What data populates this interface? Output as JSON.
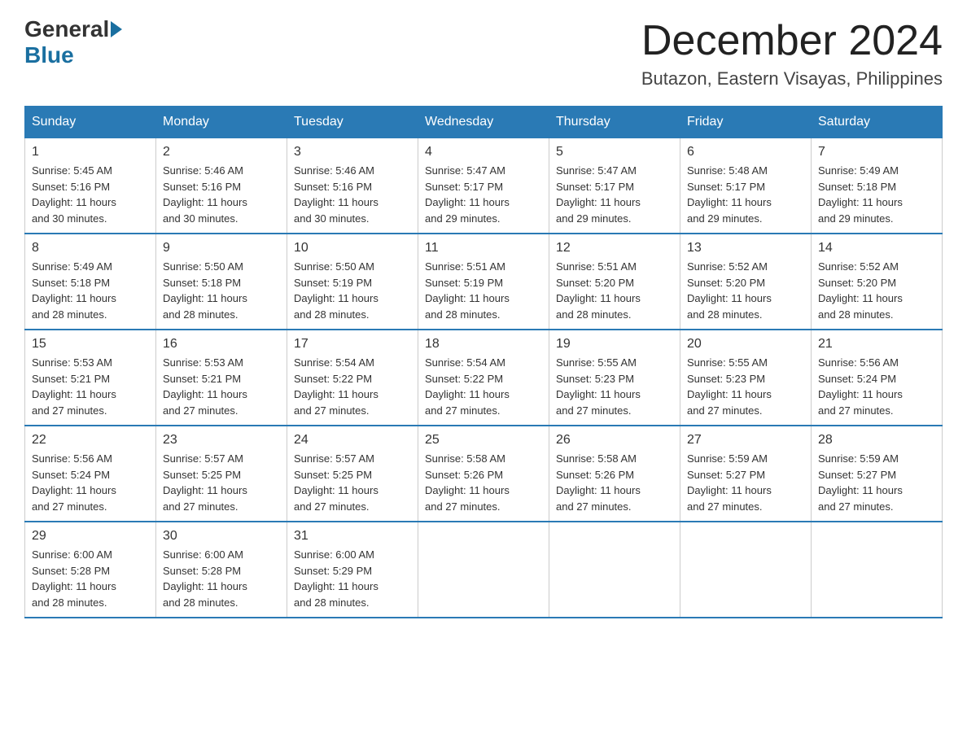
{
  "header": {
    "logo_general": "General",
    "logo_blue": "Blue",
    "month_title": "December 2024",
    "location": "Butazon, Eastern Visayas, Philippines"
  },
  "weekdays": [
    "Sunday",
    "Monday",
    "Tuesday",
    "Wednesday",
    "Thursday",
    "Friday",
    "Saturday"
  ],
  "weeks": [
    [
      {
        "day": "1",
        "sunrise": "5:45 AM",
        "sunset": "5:16 PM",
        "daylight": "11 hours and 30 minutes."
      },
      {
        "day": "2",
        "sunrise": "5:46 AM",
        "sunset": "5:16 PM",
        "daylight": "11 hours and 30 minutes."
      },
      {
        "day": "3",
        "sunrise": "5:46 AM",
        "sunset": "5:16 PM",
        "daylight": "11 hours and 30 minutes."
      },
      {
        "day": "4",
        "sunrise": "5:47 AM",
        "sunset": "5:17 PM",
        "daylight": "11 hours and 29 minutes."
      },
      {
        "day": "5",
        "sunrise": "5:47 AM",
        "sunset": "5:17 PM",
        "daylight": "11 hours and 29 minutes."
      },
      {
        "day": "6",
        "sunrise": "5:48 AM",
        "sunset": "5:17 PM",
        "daylight": "11 hours and 29 minutes."
      },
      {
        "day": "7",
        "sunrise": "5:49 AM",
        "sunset": "5:18 PM",
        "daylight": "11 hours and 29 minutes."
      }
    ],
    [
      {
        "day": "8",
        "sunrise": "5:49 AM",
        "sunset": "5:18 PM",
        "daylight": "11 hours and 28 minutes."
      },
      {
        "day": "9",
        "sunrise": "5:50 AM",
        "sunset": "5:18 PM",
        "daylight": "11 hours and 28 minutes."
      },
      {
        "day": "10",
        "sunrise": "5:50 AM",
        "sunset": "5:19 PM",
        "daylight": "11 hours and 28 minutes."
      },
      {
        "day": "11",
        "sunrise": "5:51 AM",
        "sunset": "5:19 PM",
        "daylight": "11 hours and 28 minutes."
      },
      {
        "day": "12",
        "sunrise": "5:51 AM",
        "sunset": "5:20 PM",
        "daylight": "11 hours and 28 minutes."
      },
      {
        "day": "13",
        "sunrise": "5:52 AM",
        "sunset": "5:20 PM",
        "daylight": "11 hours and 28 minutes."
      },
      {
        "day": "14",
        "sunrise": "5:52 AM",
        "sunset": "5:20 PM",
        "daylight": "11 hours and 28 minutes."
      }
    ],
    [
      {
        "day": "15",
        "sunrise": "5:53 AM",
        "sunset": "5:21 PM",
        "daylight": "11 hours and 27 minutes."
      },
      {
        "day": "16",
        "sunrise": "5:53 AM",
        "sunset": "5:21 PM",
        "daylight": "11 hours and 27 minutes."
      },
      {
        "day": "17",
        "sunrise": "5:54 AM",
        "sunset": "5:22 PM",
        "daylight": "11 hours and 27 minutes."
      },
      {
        "day": "18",
        "sunrise": "5:54 AM",
        "sunset": "5:22 PM",
        "daylight": "11 hours and 27 minutes."
      },
      {
        "day": "19",
        "sunrise": "5:55 AM",
        "sunset": "5:23 PM",
        "daylight": "11 hours and 27 minutes."
      },
      {
        "day": "20",
        "sunrise": "5:55 AM",
        "sunset": "5:23 PM",
        "daylight": "11 hours and 27 minutes."
      },
      {
        "day": "21",
        "sunrise": "5:56 AM",
        "sunset": "5:24 PM",
        "daylight": "11 hours and 27 minutes."
      }
    ],
    [
      {
        "day": "22",
        "sunrise": "5:56 AM",
        "sunset": "5:24 PM",
        "daylight": "11 hours and 27 minutes."
      },
      {
        "day": "23",
        "sunrise": "5:57 AM",
        "sunset": "5:25 PM",
        "daylight": "11 hours and 27 minutes."
      },
      {
        "day": "24",
        "sunrise": "5:57 AM",
        "sunset": "5:25 PM",
        "daylight": "11 hours and 27 minutes."
      },
      {
        "day": "25",
        "sunrise": "5:58 AM",
        "sunset": "5:26 PM",
        "daylight": "11 hours and 27 minutes."
      },
      {
        "day": "26",
        "sunrise": "5:58 AM",
        "sunset": "5:26 PM",
        "daylight": "11 hours and 27 minutes."
      },
      {
        "day": "27",
        "sunrise": "5:59 AM",
        "sunset": "5:27 PM",
        "daylight": "11 hours and 27 minutes."
      },
      {
        "day": "28",
        "sunrise": "5:59 AM",
        "sunset": "5:27 PM",
        "daylight": "11 hours and 27 minutes."
      }
    ],
    [
      {
        "day": "29",
        "sunrise": "6:00 AM",
        "sunset": "5:28 PM",
        "daylight": "11 hours and 28 minutes."
      },
      {
        "day": "30",
        "sunrise": "6:00 AM",
        "sunset": "5:28 PM",
        "daylight": "11 hours and 28 minutes."
      },
      {
        "day": "31",
        "sunrise": "6:00 AM",
        "sunset": "5:29 PM",
        "daylight": "11 hours and 28 minutes."
      },
      null,
      null,
      null,
      null
    ]
  ]
}
